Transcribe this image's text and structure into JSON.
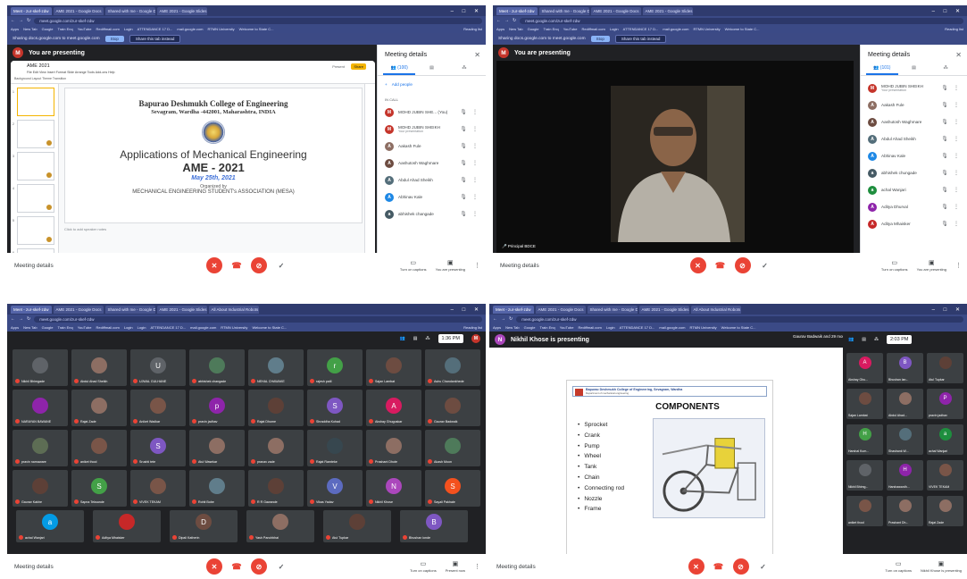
{
  "browser": {
    "tabs_q1": [
      "Meet - zur-skef-zdw",
      "AME 2021 - Google Docs",
      "Shared with me - Google Drive",
      "AME 2021 - Google Slides"
    ],
    "tabs_q3": [
      "Meet - zur-skef-zdw",
      "AME 2021 - Google Docs",
      "Shared with me - Google Drive",
      "AME 2021 - Google Slides",
      "All About Industrial Robots"
    ],
    "url": "meet.google.com/zur-skef-zdw",
    "bookmarks": [
      "Apps",
      "New Tab",
      "Google",
      "Train Enq",
      "YouTube",
      "Rediffmail.com",
      "Login",
      "Login",
      "ATTENDANCE 17 D...",
      "mail.google.com",
      "RTMN University",
      "Welcome to State C..."
    ],
    "reading_list": "Reading list",
    "share_notice": "Sharing docs.google.com to meet.google.com",
    "stop_label": "Stop",
    "share_tab_label": "Share this tab instead"
  },
  "q1": {
    "presenting": "You are presenting",
    "avatar_letter": "M",
    "doc_title": "AME 2021",
    "menu": "File  Edit  View  Insert  Format  Slide  Arrange  Tools  Add-ons  Help",
    "toolbar_hint": "Background   Layout   Theme   Transition",
    "present_label": "Present",
    "share_label": "Share",
    "slide": {
      "college": "Bapurao Deshmukh College of Engineering",
      "address": "Sevagram, Wardha -442001, Maharashtra, INDIA",
      "title": "Applications of Mechanical Engineering",
      "event": "AME - 2021",
      "date": "May 25th, 2021",
      "organized": "Organized by",
      "association": "MECHANICAL ENGINEERING STUDENT's ASSOCIATION (MESA)"
    },
    "speaker_notes": "Click to add speaker notes",
    "thumbs": [
      "1",
      "2",
      "3",
      "4",
      "5",
      "6"
    ],
    "panel": {
      "title": "Meeting details",
      "people_tab": "(100)",
      "add_people": "Add people",
      "in_call": "IN CALL",
      "people": [
        {
          "name": "MOHD JUBIN SHE... (You)",
          "sub": "",
          "color": "#c5352b",
          "letter": "M"
        },
        {
          "name": "MOHD JUBIN SHEIKH",
          "sub": "Your presentation",
          "color": "#c5352b",
          "letter": "M"
        },
        {
          "name": "Aakash Fule",
          "sub": "",
          "color": "#8d6e63",
          "letter": "A"
        },
        {
          "name": "Aashutosh Waghmare",
          "sub": "",
          "color": "#6d4c41",
          "letter": "A"
        },
        {
          "name": "Abdul Ahad Sheikh",
          "sub": "",
          "color": "#546e7a",
          "letter": "A"
        },
        {
          "name": "Abhinav Kale",
          "sub": "",
          "color": "#1e88e5",
          "letter": "A"
        },
        {
          "name": "abhishek changade",
          "sub": "",
          "color": "#455a64",
          "letter": "a"
        }
      ]
    },
    "meeting_details": "Meeting details",
    "captions": "Turn on captions",
    "you_presenting": "You are presenting"
  },
  "q2": {
    "presenting": "You are presenting",
    "speaker_name": "Principal BDCE",
    "panel": {
      "title": "Meeting details",
      "people_tab": "(101)",
      "people": [
        {
          "name": "MOHD JUBIN SHEIKH",
          "sub": "Your presentation",
          "color": "#c5352b",
          "letter": "M"
        },
        {
          "name": "Aakash Fule",
          "sub": "",
          "color": "#8d6e63",
          "letter": "A"
        },
        {
          "name": "Aashutosh Waghmare",
          "sub": "",
          "color": "#6d4c41",
          "letter": "A"
        },
        {
          "name": "Abdul Ahad Sheikh",
          "sub": "",
          "color": "#546e7a",
          "letter": "A"
        },
        {
          "name": "Abhinav Kale",
          "sub": "",
          "color": "#1e88e5",
          "letter": "A"
        },
        {
          "name": "abhishek chungade",
          "sub": "",
          "color": "#455a64",
          "letter": "a"
        },
        {
          "name": "achal Wanjari",
          "sub": "",
          "color": "#1e8e3e",
          "letter": "a"
        },
        {
          "name": "Aditya Dhurval",
          "sub": "",
          "color": "#8e24aa",
          "letter": "A"
        },
        {
          "name": "Aditya Mhaisker",
          "sub": "",
          "color": "#c62828",
          "letter": "A"
        }
      ]
    },
    "meeting_details": "Meeting details",
    "captions": "Turn on captions",
    "you_presenting": "You are presenting"
  },
  "q3": {
    "time": "1:36 PM",
    "tiles": [
      {
        "name": "Nikhil Bhimgade",
        "color": "#5f6368",
        "letter": ""
      },
      {
        "name": "Abdul Ahad Sheikh",
        "color": "#8d6e63",
        "letter": ""
      },
      {
        "name": "UJWAL GULHANE",
        "color": "#5f6368",
        "letter": "U"
      },
      {
        "name": "abhishek changade",
        "color": "#4e7a5a",
        "letter": ""
      },
      {
        "name": "NEHAL CHAWAKE",
        "color": "#607d8b",
        "letter": ""
      },
      {
        "name": "rajesh patil",
        "color": "#43a047",
        "letter": "r"
      },
      {
        "name": "Sajan Lambat",
        "color": "#6d4c41",
        "letter": ""
      },
      {
        "name": "Ashu Chandankhede",
        "color": "#546e7a",
        "letter": ""
      },
      {
        "name": "NARAYAN BAWANE",
        "color": "#8e24aa",
        "letter": ""
      },
      {
        "name": "Rajat Zade",
        "color": "#8d6e63",
        "letter": ""
      },
      {
        "name": "Aniket Wadkar",
        "color": "#795548",
        "letter": ""
      },
      {
        "name": "pravin jadhav",
        "color": "#8e24aa",
        "letter": "p"
      },
      {
        "name": "Rajat Dhume",
        "color": "#5d4037",
        "letter": ""
      },
      {
        "name": "Shraddha Kohad",
        "color": "#7e57c2",
        "letter": "S"
      },
      {
        "name": "Akshay Ghuguskar",
        "color": "#d81b60",
        "letter": "A"
      },
      {
        "name": "Gaurav Badwaik",
        "color": "#6d4c41",
        "letter": ""
      },
      {
        "name": "pravin narnaware",
        "color": "#5d6d54",
        "letter": ""
      },
      {
        "name": "aniket thool",
        "color": "#795548",
        "letter": ""
      },
      {
        "name": "Srushti tete",
        "color": "#7e57c2",
        "letter": "S"
      },
      {
        "name": "Atul Wasekar",
        "color": "#8d6e63",
        "letter": ""
      },
      {
        "name": "pranav zade",
        "color": "#8d6e63",
        "letter": ""
      },
      {
        "name": "Rajat Ramteke",
        "color": "#37474f",
        "letter": ""
      },
      {
        "name": "Prashant Dhote",
        "color": "#8d6e63",
        "letter": ""
      },
      {
        "name": "Akash Moon",
        "color": "#4e7a5a",
        "letter": ""
      },
      {
        "name": "Gaurav Kakhe",
        "color": "#5d4037",
        "letter": ""
      },
      {
        "name": "Sapna Teksande",
        "color": "#43a047",
        "letter": "S"
      },
      {
        "name": "VIVEK TEKAM",
        "color": "#795548",
        "letter": ""
      },
      {
        "name": "Rohit Bobe",
        "color": "#607d8b",
        "letter": ""
      },
      {
        "name": "R R Gawande",
        "color": "#5d4037",
        "letter": ""
      },
      {
        "name": "Vikas Yadav",
        "color": "#5c6bc0",
        "letter": "V"
      },
      {
        "name": "Nikhil Khose",
        "color": "#ab47bc",
        "letter": "N"
      },
      {
        "name": "Sayali Pakhale",
        "color": "#f4511e",
        "letter": "S"
      }
    ],
    "bottom_tiles": [
      {
        "name": "achal Wanjari",
        "color": "#039be5",
        "letter": "a"
      },
      {
        "name": "Aditya Mhaisker",
        "color": "#c62828",
        "letter": ""
      },
      {
        "name": "Dipali Katherin",
        "color": "#6d4c41",
        "letter": "D"
      },
      {
        "name": "Yash Panchbhai",
        "color": "#8d6e63",
        "letter": ""
      },
      {
        "name": "Atul Tupkar",
        "color": "#5d4037",
        "letter": ""
      },
      {
        "name": "Bhushan ionde",
        "color": "#7e57c2",
        "letter": "B"
      }
    ],
    "meeting_details": "Meeting details",
    "captions": "Turn on captions",
    "present_now": "Present now"
  },
  "q4": {
    "presenting": "Nikhil Khose is presenting",
    "top_right": "Gaurav Badwaik and 29 more",
    "time": "2:03 PM",
    "slide_header": "Bapurao Deshmukh College of Engineering, Sevagram, Wardha",
    "slide_sub": "Department of mechanical engineering",
    "slide_title": "COMPONENTS",
    "components": [
      "Sprocket",
      "Crank",
      "Pump",
      "Wheel",
      "Tank",
      "Chain",
      "Connecting rod",
      "Nozzle",
      "Frame"
    ],
    "side_tiles": [
      {
        "name": "Akshay Ghu...",
        "color": "#d81b60",
        "letter": "A"
      },
      {
        "name": "Bhushan lan...",
        "color": "#7e57c2",
        "letter": "B"
      },
      {
        "name": "Atul Tupkar",
        "color": "#5d4037",
        "letter": ""
      },
      {
        "name": "Sajan Lambat",
        "color": "#6d4c41",
        "letter": ""
      },
      {
        "name": "Abdul Ahad...",
        "color": "#8d6e63",
        "letter": ""
      },
      {
        "name": "pravin jadhav",
        "color": "#8e24aa",
        "letter": "P"
      },
      {
        "name": "Harshal Kum...",
        "color": "#43a047",
        "letter": "H"
      },
      {
        "name": "Shashank W...",
        "color": "#546e7a",
        "letter": ""
      },
      {
        "name": "achal Wanjari",
        "color": "#1e8e3e",
        "letter": "a"
      },
      {
        "name": "Nikhil Bhimg...",
        "color": "#5f6368",
        "letter": ""
      },
      {
        "name": "Harshawardh...",
        "color": "#8e24aa",
        "letter": "H"
      },
      {
        "name": "VIVEK TEKAM",
        "color": "#795548",
        "letter": ""
      },
      {
        "name": "aniket thool",
        "color": "#795548",
        "letter": ""
      },
      {
        "name": "Prashant Dh...",
        "color": "#8d6e63",
        "letter": ""
      },
      {
        "name": "Rajat Zade",
        "color": "#8d6e63",
        "letter": ""
      }
    ],
    "meeting_details": "Meeting details",
    "captions": "Turn on captions",
    "presenting_short": "Nikhil Khose is presenting"
  }
}
